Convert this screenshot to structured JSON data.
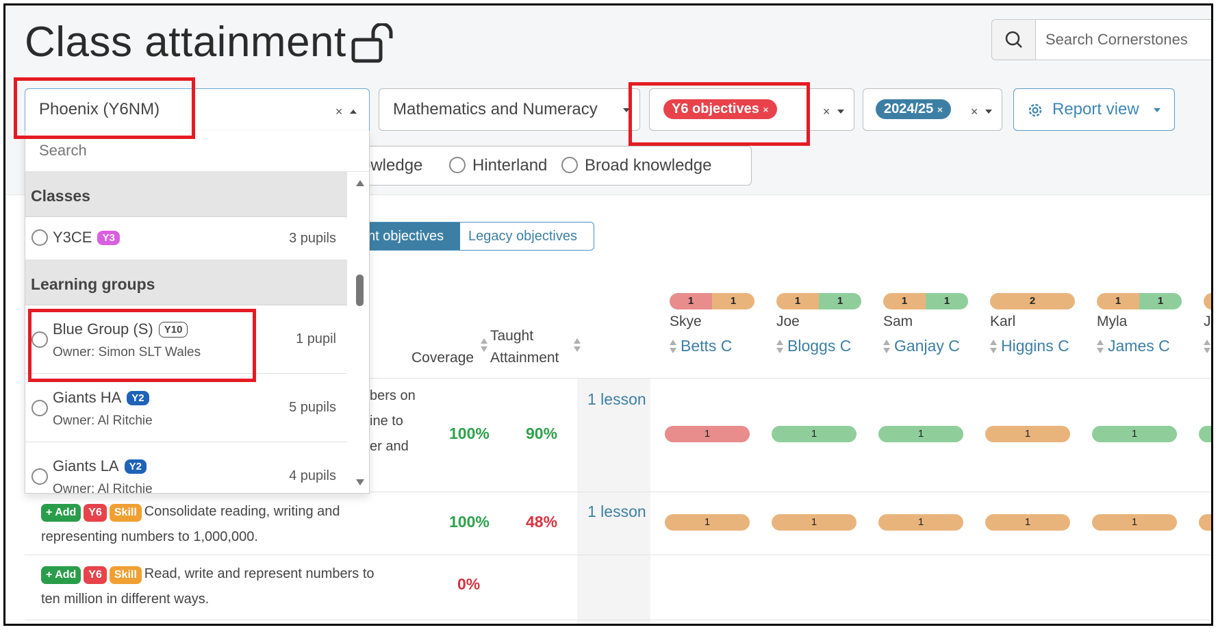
{
  "page": {
    "title": "Class attainment"
  },
  "search": {
    "placeholder": "Search Cornerstones"
  },
  "filters": {
    "class_value": "Phoenix (Y6NM)",
    "subject_value": "Mathematics and Numeracy",
    "objectives_pill": "Y6 objectives",
    "year_pill": "2024/25",
    "report_view": "Report view",
    "clear": "×"
  },
  "knowledge_options": [
    "owledge",
    "Hinterland",
    "Broad knowledge"
  ],
  "objective_toggle": {
    "active": "nt objectives",
    "inactive": "Legacy objectives"
  },
  "table": {
    "coverage_header": "Coverage",
    "taught_header_1": "Taught",
    "taught_header_2": "Attainment",
    "pupils": [
      {
        "first": "Skye",
        "last": "Betts C",
        "summary": [
          {
            "n": "1",
            "color": "#e88c8c"
          },
          {
            "n": "1",
            "color": "#e9b47c"
          }
        ]
      },
      {
        "first": "Joe",
        "last": "Bloggs C",
        "summary": [
          {
            "n": "1",
            "color": "#e9b47c"
          },
          {
            "n": "1",
            "color": "#8fce9a"
          }
        ]
      },
      {
        "first": "Sam",
        "last": "Ganjay C",
        "summary": [
          {
            "n": "1",
            "color": "#e9b47c"
          },
          {
            "n": "1",
            "color": "#8fce9a"
          }
        ]
      },
      {
        "first": "Karl",
        "last": "Higgins C",
        "summary": [
          {
            "n": "2",
            "color": "#e9b47c"
          }
        ]
      },
      {
        "first": "Myla",
        "last": "James C",
        "summary": [
          {
            "n": "1",
            "color": "#e9b47c"
          },
          {
            "n": "1",
            "color": "#8fce9a"
          }
        ]
      },
      {
        "first": "J",
        "last": "J",
        "summary": [
          {
            "n": "",
            "color": "#e9b47c"
          }
        ]
      }
    ],
    "rows": [
      {
        "partial_lines": [
          "bers on",
          "ine to",
          "er and"
        ],
        "coverage": "100%",
        "attainment": "90%",
        "attainment_color": "green",
        "lesson": "1 lesson",
        "cells": [
          {
            "n": "1",
            "color": "#e88c8c"
          },
          {
            "n": "1",
            "color": "#8fce9a"
          },
          {
            "n": "1",
            "color": "#8fce9a"
          },
          {
            "n": "1",
            "color": "#e9b47c"
          },
          {
            "n": "1",
            "color": "#8fce9a"
          },
          {
            "n": "",
            "color": "#8fce9a"
          }
        ]
      },
      {
        "add": "+ Add",
        "year": "Y6",
        "type": "Skill",
        "text_line1": "Consolidate reading, writing and",
        "text_line2": "representing numbers to 1,000,000.",
        "coverage": "100%",
        "attainment": "48%",
        "attainment_color": "red",
        "lesson": "1 lesson",
        "cells": [
          {
            "n": "1",
            "color": "#e9b47c"
          },
          {
            "n": "1",
            "color": "#e9b47c"
          },
          {
            "n": "1",
            "color": "#e9b47c"
          },
          {
            "n": "1",
            "color": "#e9b47c"
          },
          {
            "n": "1",
            "color": "#e9b47c"
          },
          {
            "n": "",
            "color": "#e9b47c"
          }
        ]
      },
      {
        "add": "+ Add",
        "year": "Y6",
        "type": "Skill",
        "text_line1": "Read, write and represent numbers to",
        "text_line2": "ten million in different ways.",
        "coverage": "0%"
      }
    ]
  },
  "dropdown": {
    "search_placeholder": "Search",
    "classes_header": "Classes",
    "classes": [
      {
        "name": "Y3CE",
        "badge": "Y3",
        "count": "3 pupils"
      }
    ],
    "groups_header": "Learning groups",
    "groups": [
      {
        "name": "Blue Group (S)",
        "badge": "Y10",
        "owner": "Owner: Simon SLT Wales",
        "count": "1 pupil"
      },
      {
        "name": "Giants HA",
        "badge": "Y2",
        "owner": "Owner: Al Ritchie",
        "count": "5 pupils"
      },
      {
        "name": "Giants LA",
        "badge": "Y2",
        "owner": "Owner: Al Ritchie",
        "count": "4 pupils"
      }
    ]
  },
  "colors": {
    "accent": "#3d7fa4",
    "highlight": "#e41b23",
    "red_status": "#e88c8c",
    "amber_status": "#e9b47c",
    "green_status": "#8fce9a"
  }
}
